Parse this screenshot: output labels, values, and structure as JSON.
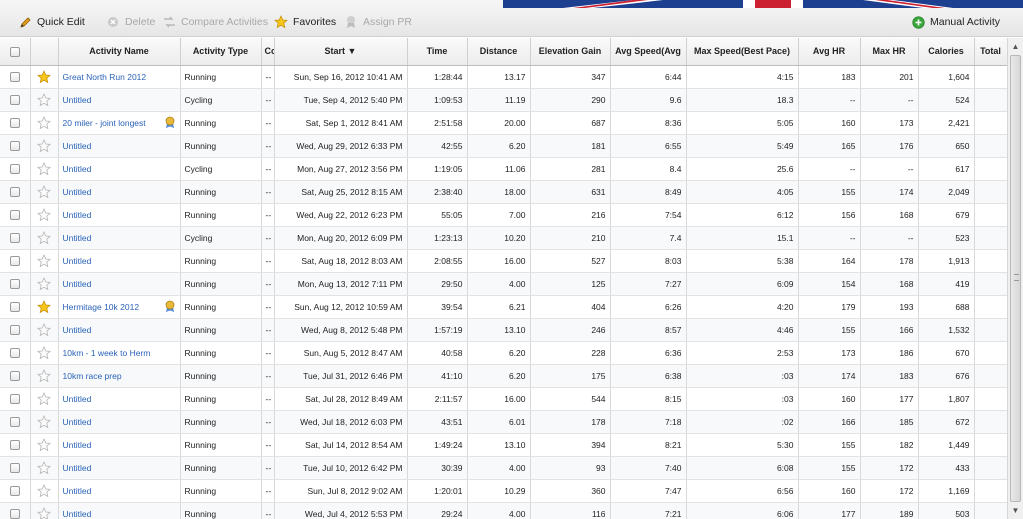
{
  "toolbar": {
    "quick_edit": "Quick Edit",
    "delete": "Delete",
    "compare": "Compare Activities",
    "favorites": "Favorites",
    "assign_pr": "Assign PR",
    "manual_activity": "Manual Activity",
    "accent_color": "#2a62b8"
  },
  "columns": [
    "",
    "",
    "Activity Name",
    "Activity Type",
    "Co",
    "Start",
    "Time",
    "Distance",
    "Elevation Gain",
    "Avg Speed(Avg",
    "Max Speed(Best Pace)",
    "Avg HR",
    "Max HR",
    "Calories",
    "Total"
  ],
  "rows": [
    {
      "fav": true,
      "pr": false,
      "name": "Great North Run 2012",
      "type": "Running",
      "co": "--",
      "start": "Sun, Sep 16, 2012 10:41 AM",
      "time": "1:28:44",
      "distance": "13.17",
      "elev": "347",
      "avg": "6:44",
      "max": "4:15",
      "avghr": "183",
      "maxhr": "201",
      "cal": "1,604"
    },
    {
      "fav": false,
      "pr": false,
      "name": "Untitled",
      "type": "Cycling",
      "co": "--",
      "start": "Tue, Sep 4, 2012 5:40 PM",
      "time": "1:09:53",
      "distance": "11.19",
      "elev": "290",
      "avg": "9.6",
      "max": "18.3",
      "avghr": "--",
      "maxhr": "--",
      "cal": "524"
    },
    {
      "fav": false,
      "pr": true,
      "name": "20 miler - joint longest",
      "type": "Running",
      "co": "--",
      "start": "Sat, Sep 1, 2012 8:41 AM",
      "time": "2:51:58",
      "distance": "20.00",
      "elev": "687",
      "avg": "8:36",
      "max": "5:05",
      "avghr": "160",
      "maxhr": "173",
      "cal": "2,421"
    },
    {
      "fav": false,
      "pr": false,
      "name": "Untitled",
      "type": "Running",
      "co": "--",
      "start": "Wed, Aug 29, 2012 6:33 PM",
      "time": "42:55",
      "distance": "6.20",
      "elev": "181",
      "avg": "6:55",
      "max": "5:49",
      "avghr": "165",
      "maxhr": "176",
      "cal": "650"
    },
    {
      "fav": false,
      "pr": false,
      "name": "Untitled",
      "type": "Cycling",
      "co": "--",
      "start": "Mon, Aug 27, 2012 3:56 PM",
      "time": "1:19:05",
      "distance": "11.06",
      "elev": "281",
      "avg": "8.4",
      "max": "25.6",
      "avghr": "--",
      "maxhr": "--",
      "cal": "617"
    },
    {
      "fav": false,
      "pr": false,
      "name": "Untitled",
      "type": "Running",
      "co": "--",
      "start": "Sat, Aug 25, 2012 8:15 AM",
      "time": "2:38:40",
      "distance": "18.00",
      "elev": "631",
      "avg": "8:49",
      "max": "4:05",
      "avghr": "155",
      "maxhr": "174",
      "cal": "2,049"
    },
    {
      "fav": false,
      "pr": false,
      "name": "Untitled",
      "type": "Running",
      "co": "--",
      "start": "Wed, Aug 22, 2012 6:23 PM",
      "time": "55:05",
      "distance": "7.00",
      "elev": "216",
      "avg": "7:54",
      "max": "6:12",
      "avghr": "156",
      "maxhr": "168",
      "cal": "679"
    },
    {
      "fav": false,
      "pr": false,
      "name": "Untitled",
      "type": "Cycling",
      "co": "--",
      "start": "Mon, Aug 20, 2012 6:09 PM",
      "time": "1:23:13",
      "distance": "10.20",
      "elev": "210",
      "avg": "7.4",
      "max": "15.1",
      "avghr": "--",
      "maxhr": "--",
      "cal": "523"
    },
    {
      "fav": false,
      "pr": false,
      "name": "Untitled",
      "type": "Running",
      "co": "--",
      "start": "Sat, Aug 18, 2012 8:03 AM",
      "time": "2:08:55",
      "distance": "16.00",
      "elev": "527",
      "avg": "8:03",
      "max": "5:38",
      "avghr": "164",
      "maxhr": "178",
      "cal": "1,913"
    },
    {
      "fav": false,
      "pr": false,
      "name": "Untitled",
      "type": "Running",
      "co": "--",
      "start": "Mon, Aug 13, 2012 7:11 PM",
      "time": "29:50",
      "distance": "4.00",
      "elev": "125",
      "avg": "7:27",
      "max": "6:09",
      "avghr": "154",
      "maxhr": "168",
      "cal": "419"
    },
    {
      "fav": true,
      "pr": true,
      "name": "Hermitage 10k 2012",
      "type": "Running",
      "co": "--",
      "start": "Sun, Aug 12, 2012 10:59 AM",
      "time": "39:54",
      "distance": "6.21",
      "elev": "404",
      "avg": "6:26",
      "max": "4:20",
      "avghr": "179",
      "maxhr": "193",
      "cal": "688"
    },
    {
      "fav": false,
      "pr": false,
      "name": "Untitled",
      "type": "Running",
      "co": "--",
      "start": "Wed, Aug 8, 2012 5:48 PM",
      "time": "1:57:19",
      "distance": "13.10",
      "elev": "246",
      "avg": "8:57",
      "max": "4:46",
      "avghr": "155",
      "maxhr": "166",
      "cal": "1,532"
    },
    {
      "fav": false,
      "pr": false,
      "name": "10km - 1 week to Herm",
      "type": "Running",
      "co": "--",
      "start": "Sun, Aug 5, 2012 8:47 AM",
      "time": "40:58",
      "distance": "6.20",
      "elev": "228",
      "avg": "6:36",
      "max": "2:53",
      "avghr": "173",
      "maxhr": "186",
      "cal": "670"
    },
    {
      "fav": false,
      "pr": false,
      "name": "10km race prep",
      "type": "Running",
      "co": "--",
      "start": "Tue, Jul 31, 2012 6:46 PM",
      "time": "41:10",
      "distance": "6.20",
      "elev": "175",
      "avg": "6:38",
      "max": ":03",
      "avghr": "174",
      "maxhr": "183",
      "cal": "676"
    },
    {
      "fav": false,
      "pr": false,
      "name": "Untitled",
      "type": "Running",
      "co": "--",
      "start": "Sat, Jul 28, 2012 8:49 AM",
      "time": "2:11:57",
      "distance": "16.00",
      "elev": "544",
      "avg": "8:15",
      "max": ":03",
      "avghr": "160",
      "maxhr": "177",
      "cal": "1,807"
    },
    {
      "fav": false,
      "pr": false,
      "name": "Untitled",
      "type": "Running",
      "co": "--",
      "start": "Wed, Jul 18, 2012 6:03 PM",
      "time": "43:51",
      "distance": "6.01",
      "elev": "178",
      "avg": "7:18",
      "max": ":02",
      "avghr": "166",
      "maxhr": "185",
      "cal": "672"
    },
    {
      "fav": false,
      "pr": false,
      "name": "Untitled",
      "type": "Running",
      "co": "--",
      "start": "Sat, Jul 14, 2012 8:54 AM",
      "time": "1:49:24",
      "distance": "13.10",
      "elev": "394",
      "avg": "8:21",
      "max": "5:30",
      "avghr": "155",
      "maxhr": "182",
      "cal": "1,449"
    },
    {
      "fav": false,
      "pr": false,
      "name": "Untitled",
      "type": "Running",
      "co": "--",
      "start": "Tue, Jul 10, 2012 6:42 PM",
      "time": "30:39",
      "distance": "4.00",
      "elev": "93",
      "avg": "7:40",
      "max": "6:08",
      "avghr": "155",
      "maxhr": "172",
      "cal": "433"
    },
    {
      "fav": false,
      "pr": false,
      "name": "Untitled",
      "type": "Running",
      "co": "--",
      "start": "Sun, Jul 8, 2012 9:02 AM",
      "time": "1:20:01",
      "distance": "10.29",
      "elev": "360",
      "avg": "7:47",
      "max": "6:56",
      "avghr": "160",
      "maxhr": "172",
      "cal": "1,169"
    },
    {
      "fav": false,
      "pr": false,
      "name": "Untitled",
      "type": "Running",
      "co": "--",
      "start": "Wed, Jul 4, 2012 5:53 PM",
      "time": "29:24",
      "distance": "4.00",
      "elev": "116",
      "avg": "7:21",
      "max": "6:06",
      "avghr": "177",
      "maxhr": "189",
      "cal": "503"
    }
  ]
}
